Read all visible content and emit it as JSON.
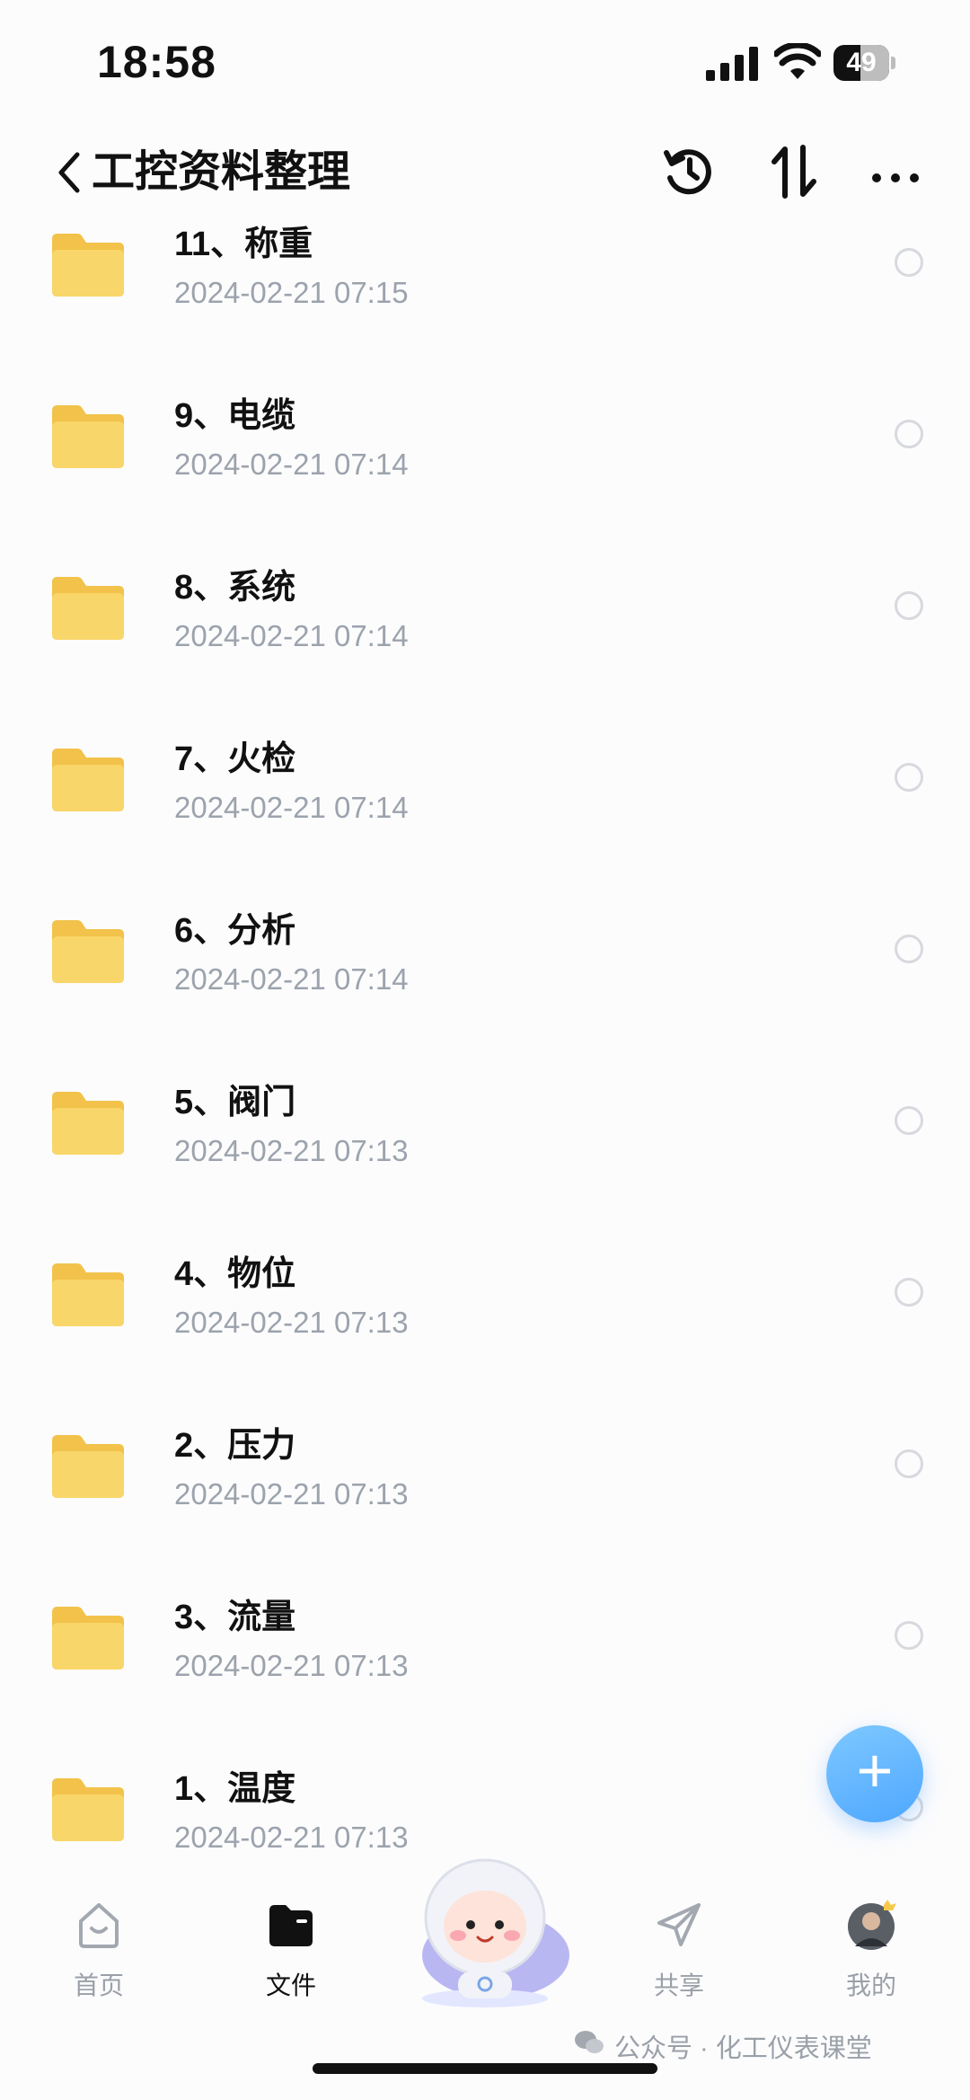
{
  "status": {
    "time": "18:58",
    "battery": "49"
  },
  "header": {
    "title": "工控资料整理"
  },
  "files": [
    {
      "name": "11、称重",
      "date": "2024-02-21 07:15"
    },
    {
      "name": "9、电缆",
      "date": "2024-02-21 07:14"
    },
    {
      "name": "8、系统",
      "date": "2024-02-21 07:14"
    },
    {
      "name": "7、火检",
      "date": "2024-02-21 07:14"
    },
    {
      "name": "6、分析",
      "date": "2024-02-21 07:14"
    },
    {
      "name": "5、阀门",
      "date": "2024-02-21 07:13"
    },
    {
      "name": "4、物位",
      "date": "2024-02-21 07:13"
    },
    {
      "name": "2、压力",
      "date": "2024-02-21 07:13"
    },
    {
      "name": "3、流量",
      "date": "2024-02-21 07:13"
    },
    {
      "name": "1、温度",
      "date": "2024-02-21 07:13"
    }
  ],
  "nav": {
    "home": "首页",
    "files": "文件",
    "share": "共享",
    "mine": "我的"
  },
  "watermark": "公众号 · 化工仪表课堂",
  "icons": {
    "back": "chevron-left-icon",
    "history": "history-icon",
    "sort": "sort-icon",
    "more": "more-icon",
    "folder": "folder-icon",
    "add": "plus-icon"
  },
  "colors": {
    "accent": "#4ea7ff",
    "folder": "#f7cf5a",
    "muted": "#9ca3ad"
  }
}
